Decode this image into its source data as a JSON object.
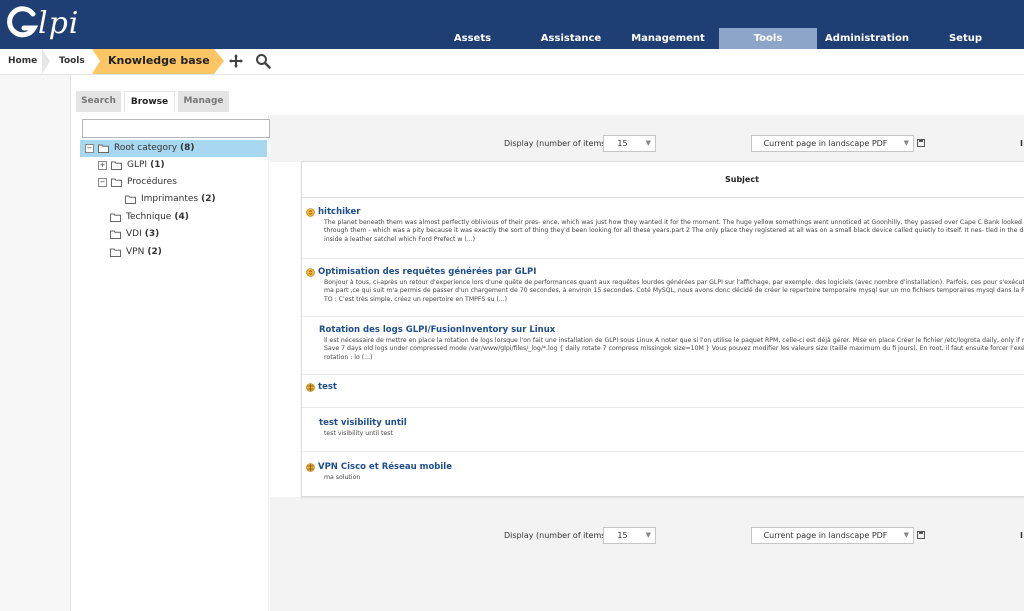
{
  "app": {
    "logo_text": "lpi"
  },
  "nav": {
    "items": [
      {
        "label": "Assets"
      },
      {
        "label": "Assistance"
      },
      {
        "label": "Management"
      },
      {
        "label": "Tools"
      },
      {
        "label": "Administration"
      },
      {
        "label": "Setup"
      }
    ],
    "active": "Tools",
    "colors": {
      "bar": "#1f3f74",
      "active": "#8ca5c8"
    }
  },
  "breadcrumb": {
    "home": "Home",
    "tools": "Tools",
    "current": "Knowledge base",
    "add_icon": "add-icon",
    "search_icon": "search-icon",
    "current_color": "#fdc563"
  },
  "tabs": [
    {
      "label": "Search"
    },
    {
      "label": "Browse",
      "active": true
    },
    {
      "label": "Manage"
    }
  ],
  "tree": {
    "search_value": "",
    "nodes": [
      {
        "label": "Root category",
        "count": "(8)",
        "toggle": "−",
        "selected": true
      },
      {
        "label": "GLPI",
        "count": "(1)",
        "toggle": "+"
      },
      {
        "label": "Procédures",
        "count": "",
        "toggle": "−"
      },
      {
        "label": "Imprimantes",
        "count": "(2)",
        "toggle": ""
      },
      {
        "label": "Technique",
        "count": "(4)",
        "toggle": ""
      },
      {
        "label": "VDI",
        "count": "(3)",
        "toggle": ""
      },
      {
        "label": "VPN",
        "count": "(2)",
        "toggle": ""
      }
    ]
  },
  "pager_top": {
    "label": "Display (number of items)",
    "count": "15",
    "export": "Current page in landscape PDF",
    "edge": "I"
  },
  "pager_bottom": {
    "label": "Display (number of items)",
    "count": "15",
    "export": "Current page in landscape PDF",
    "edge": "I"
  },
  "table": {
    "header": "Subject",
    "rows": [
      {
        "title": "hitchiker",
        "icon": "faq-icon",
        "text": "The planet beneath them was almost perfectly oblivious of their pres- ence, which was just how they wanted it for the moment. The huge yellow somethings went unnoticed at Goonhilly, they passed over Cape C Bank looked straight through them - which was a pity because it was exactly the sort of thing they'd been looking for all these years.part 2 The only place they registered at all was on a small black device called quietly to itself. It nes- tled in the darkness inside a leather satchel which Ford Prefect w (...)"
      },
      {
        "title": "Optimisation des requêtes générées par GLPI",
        "icon": "faq-icon",
        "text": "Bonjour à tous, ci-après un retour d'experience lors d'une quête de performances quant aux requêtes lourdes générées par GLPI sur l'affichage, par exemple, des logiciels (avec nombre d'installation). Parfois, ces pour s'exécuter... Pour ma part ,ce qui suit m'a permis de passer d'un chargement de 70 secondes, à environ 15 secondes. Coté MySQL, nous avons donc décidé de créer le repertoire temporaire mysql sur un mo fichiers temporaires mysql dans la RAM. HOW TO : C'est très simple, créez un repertoire en TMPFS su (...)"
      },
      {
        "title": "Rotation des logs GLPI/FusionInventory sur Linux",
        "icon": "",
        "text": "Il est nécessaire de mettre en place la rotation de logs lorsque l'on fait une installation de GLPI sous Linux A noter que si l'on utilise le paquet RPM, celle-ci est déjà gérer. Mise en place Créer le fichier /etc/logrota daily, only if not empty # Save 7 days old logs under compressed mode /var/www/glpi/files/_log/*.log { daily rotate 7 compress missingok size=10M } Vous pouvez modifier les valeurs size (taille maximum du fi jours). En root, il faut ensuite forcer l'exécution de la rotation : lo (...)"
      },
      {
        "title": "test",
        "icon": "public-faq-icon",
        "text": ""
      },
      {
        "title": "test visibility until",
        "icon": "",
        "text": "test visibility until test"
      },
      {
        "title": "VPN Cisco et Réseau mobile",
        "icon": "public-faq-icon",
        "text": "ma solution"
      }
    ]
  }
}
